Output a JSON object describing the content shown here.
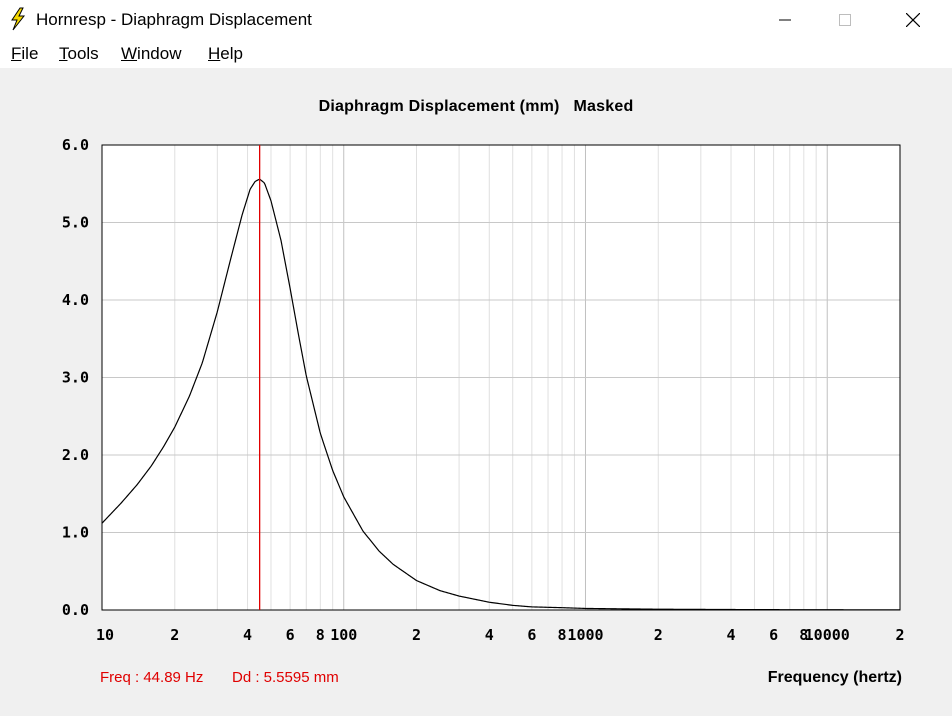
{
  "window": {
    "title": "Hornresp - Diaphragm Displacement",
    "minimize_icon": "minimize-icon",
    "maximize_icon": "maximize-icon",
    "close_icon": "close-icon",
    "app_icon": "lightning-icon"
  },
  "menu": [
    {
      "key": "F",
      "rest": "ile"
    },
    {
      "key": "T",
      "rest": "ools"
    },
    {
      "key": "W",
      "rest": "indow"
    },
    {
      "key": "H",
      "rest": "elp"
    }
  ],
  "status": {
    "freq": "Freq : 44.89 Hz",
    "dd": "Dd : 5.5595 mm"
  },
  "colors": {
    "curve": "#000000",
    "cursor": "#e00000",
    "grid": "#c8c8c8",
    "plot_bg": "#ffffff"
  },
  "chart_data": {
    "type": "line",
    "title": "Diaphragm Displacement (mm)   Masked",
    "xlabel": "Frequency (hertz)",
    "ylabel": "",
    "x_scale": "log",
    "xlim": [
      10,
      20000
    ],
    "ylim": [
      0,
      6
    ],
    "y_ticks": [
      "0.0",
      "1.0",
      "2.0",
      "3.0",
      "4.0",
      "5.0",
      "6.0"
    ],
    "x_tick_labels": [
      {
        "value": 10,
        "label": "10"
      },
      {
        "value": 20,
        "label": "2"
      },
      {
        "value": 40,
        "label": "4"
      },
      {
        "value": 60,
        "label": "6"
      },
      {
        "value": 80,
        "label": "8"
      },
      {
        "value": 100,
        "label": "100"
      },
      {
        "value": 200,
        "label": "2"
      },
      {
        "value": 400,
        "label": "4"
      },
      {
        "value": 600,
        "label": "6"
      },
      {
        "value": 800,
        "label": "8"
      },
      {
        "value": 1000,
        "label": "1000"
      },
      {
        "value": 2000,
        "label": "2"
      },
      {
        "value": 4000,
        "label": "4"
      },
      {
        "value": 6000,
        "label": "6"
      },
      {
        "value": 8000,
        "label": "8"
      },
      {
        "value": 10000,
        "label": "10000"
      },
      {
        "value": 20000,
        "label": "2"
      }
    ],
    "grid": true,
    "cursor_x": 44.89,
    "series": [
      {
        "x": [
          10,
          12,
          14,
          16,
          18,
          20,
          23,
          26,
          30,
          34,
          38,
          41,
          43,
          44.89,
          47,
          50,
          55,
          60,
          65,
          70,
          80,
          90,
          100,
          120,
          140,
          160,
          200,
          250,
          300,
          400,
          500,
          600,
          800,
          1000,
          2000,
          5000,
          10000,
          20000
        ],
        "y": [
          1.12,
          1.38,
          1.62,
          1.86,
          2.11,
          2.36,
          2.76,
          3.19,
          3.85,
          4.52,
          5.1,
          5.43,
          5.53,
          5.56,
          5.51,
          5.28,
          4.77,
          4.15,
          3.55,
          3.02,
          2.28,
          1.8,
          1.46,
          1.02,
          0.76,
          0.59,
          0.38,
          0.25,
          0.18,
          0.1,
          0.06,
          0.04,
          0.03,
          0.02,
          0.01,
          0.005,
          0.003,
          0.002
        ]
      }
    ]
  }
}
